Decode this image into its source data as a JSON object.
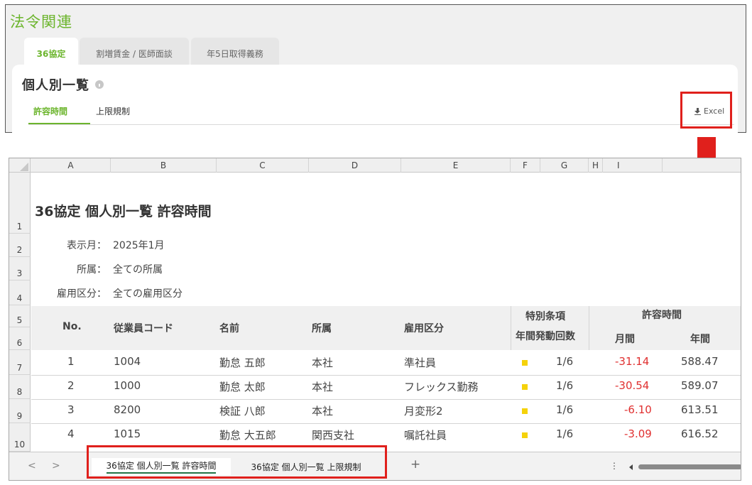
{
  "app": {
    "title": "法令関連",
    "tabs": [
      {
        "label": "36協定",
        "active": true
      },
      {
        "label": "割増賃金 / 医師面談",
        "active": false
      },
      {
        "label": "年5日取得義務",
        "active": false
      }
    ],
    "card_title": "個人別一覧",
    "sub_tabs": [
      {
        "label": "許容時間",
        "active": true
      },
      {
        "label": "上限規制",
        "active": false
      }
    ],
    "excel_label": "Excel",
    "accent_color": "#6cb52d",
    "highlight_color": "#e0201c"
  },
  "sheet": {
    "columns": [
      "A",
      "B",
      "C",
      "D",
      "E",
      "F",
      "G",
      "H",
      "I"
    ],
    "rows": [
      "1",
      "2",
      "3",
      "4",
      "5",
      "6",
      "7",
      "8",
      "9",
      "10"
    ],
    "title": "36協定 個人別一覧 許容時間",
    "meta": [
      {
        "label": "表示月：",
        "value": "2025年1月"
      },
      {
        "label": "所属：",
        "value": "全ての所属"
      },
      {
        "label": "雇用区分：",
        "value": "全ての雇用区分"
      }
    ],
    "headers": {
      "no": "No.",
      "code": "従業員コード",
      "name": "名前",
      "dept": "所属",
      "emp_type": "雇用区分",
      "special_1": "特別条項",
      "special_2": "年間発動回数",
      "allow": "許容時間",
      "monthly": "月間",
      "annual": "年間"
    },
    "data": [
      {
        "no": "1",
        "code": "1004",
        "name": "勤怠 五郎",
        "dept": "本社",
        "emp_type": "準社員",
        "count": "1/6",
        "monthly": "-31.14",
        "annual": "588.47"
      },
      {
        "no": "2",
        "code": "1000",
        "name": "勤怠 太郎",
        "dept": "本社",
        "emp_type": "フレックス勤務",
        "count": "1/6",
        "monthly": "-30.54",
        "annual": "589.07"
      },
      {
        "no": "3",
        "code": "8200",
        "name": "検証 八郎",
        "dept": "本社",
        "emp_type": "月変形2",
        "count": "1/6",
        "monthly": "-6.10",
        "annual": "613.51"
      },
      {
        "no": "4",
        "code": "1015",
        "name": "勤怠 大五郎",
        "dept": "関西支社",
        "emp_type": "嘱託社員",
        "count": "1/6",
        "monthly": "-3.09",
        "annual": "616.52"
      }
    ],
    "sheet_tabs": [
      {
        "label": "36協定 個人別一覧 許容時間",
        "active": true
      },
      {
        "label": "36協定 個人別一覧 上限規制",
        "active": false
      }
    ],
    "add_sheet": "+",
    "nav_prev": "<",
    "nav_next": ">",
    "more": "⋮",
    "marker_color": "#f5d20a",
    "negative_color": "#e03030"
  }
}
